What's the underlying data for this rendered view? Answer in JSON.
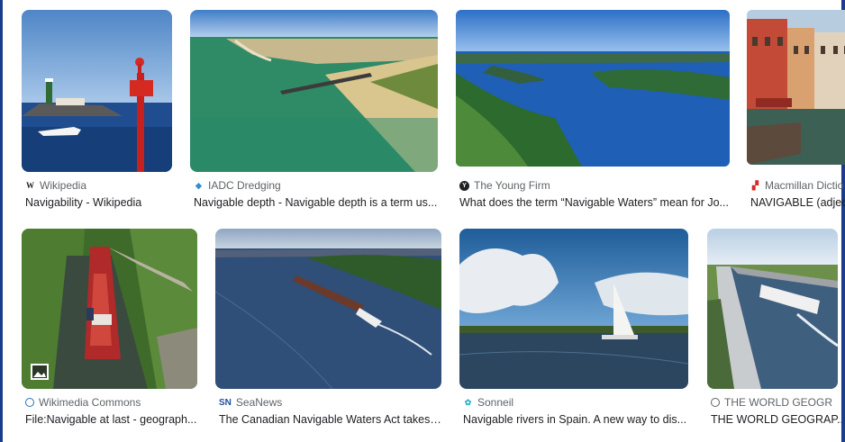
{
  "results": [
    {
      "source": "Wikipedia",
      "title": "Navigability - Wikipedia",
      "icon": "wikipedia-icon"
    },
    {
      "source": "IADC Dredging",
      "title": "Navigable depth - Navigable depth is a term us...",
      "icon": "iadc-icon"
    },
    {
      "source": "The Young Firm",
      "title": "What does the term “Navigable Waters” mean for Jo...",
      "icon": "young-firm-icon"
    },
    {
      "source": "Macmillan Dictio",
      "title": "NAVIGABLE (adject",
      "icon": "macmillan-icon"
    },
    {
      "source": "Wikimedia Commons",
      "title": "File:Navigable at last - geograph...",
      "icon": "wikimedia-icon"
    },
    {
      "source": "SeaNews",
      "title": "The Canadian Navigable Waters Act takes ...",
      "icon": "seanews-icon"
    },
    {
      "source": "Sonneil",
      "title": "Navigable rivers in Spain. A new way to dis...",
      "icon": "sonneil-icon"
    },
    {
      "source": "THE WORLD GEOGR",
      "title": "THE WORLD GEOGRAP...",
      "icon": "globe-icon"
    }
  ]
}
